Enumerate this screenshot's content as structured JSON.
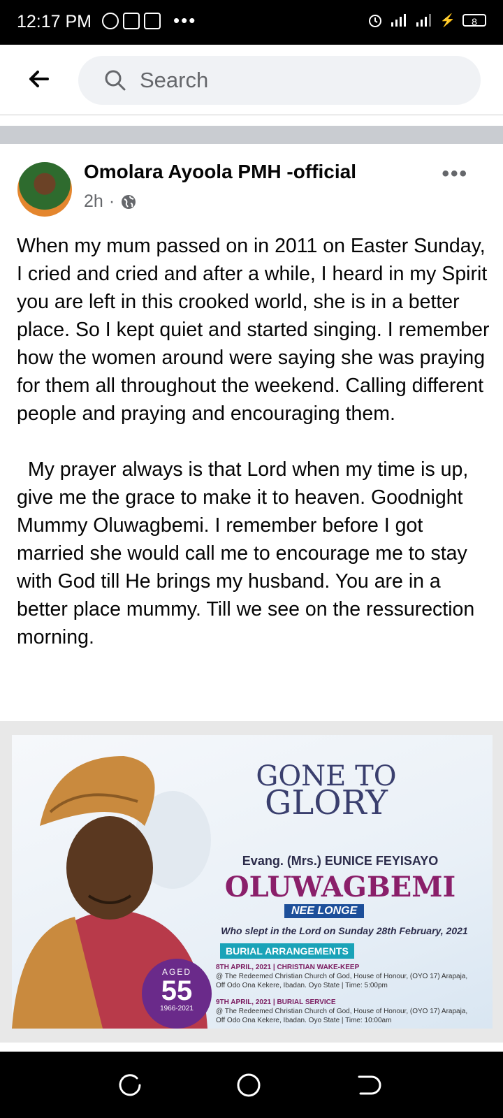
{
  "status_bar": {
    "time": "12:17 PM",
    "battery": "8"
  },
  "search": {
    "placeholder": "Search"
  },
  "post": {
    "author": "Omolara Ayoola PMH -official",
    "time": "2h",
    "separator": "·",
    "more": "•••",
    "paragraphs": [
      "When my mum passed on in 2011 on Easter Sunday,  I cried and cried and after a while, I heard in my Spirit  you are left in this crooked world, she is in a better place. So I kept quiet and started singing. I remember how the women around were saying she was praying for them all throughout the weekend. Calling different people and praying and encouraging them.",
      "  My prayer always is that Lord when my time is up,  give me the grace to make it to heaven. Goodnight Mummy Oluwagbemi. I remember before I got married she would call me to encourage me to stay with God till He brings my husband. You are in a better place mummy. Till we see on the ressurection morning."
    ]
  },
  "poster": {
    "gone_to": "GONE TO",
    "glory": "GLORY",
    "name_line": "Evang. (Mrs.) EUNICE FEYISAYO",
    "surname": "OLUWAGBEMI",
    "nee": "NEE LONGE",
    "slept": "Who slept in the Lord on Sunday 28th February, 2021",
    "burial_title": "BURIAL ARRANGEMENTS",
    "event1_title": "8TH APRIL, 2021 | CHRISTIAN WAKE-KEEP",
    "event1_details": "@ The Redeemed Christian Church of God, House of Honour, (OYO 17) Arapaja, Off Odo Ona Kekere, Ibadan. Oyo State | Time: 5:00pm",
    "event2_title": "9TH APRIL, 2021 | BURIAL SERVICE",
    "event2_details": "@ The Redeemed Christian Church of God, House of Honour, (OYO 17) Arapaja, Off Odo Ona Kekere, Ibadan. Oyo State | Time: 10:00am",
    "aged_label": "AGED",
    "age": "55",
    "years": "1966-2021"
  }
}
